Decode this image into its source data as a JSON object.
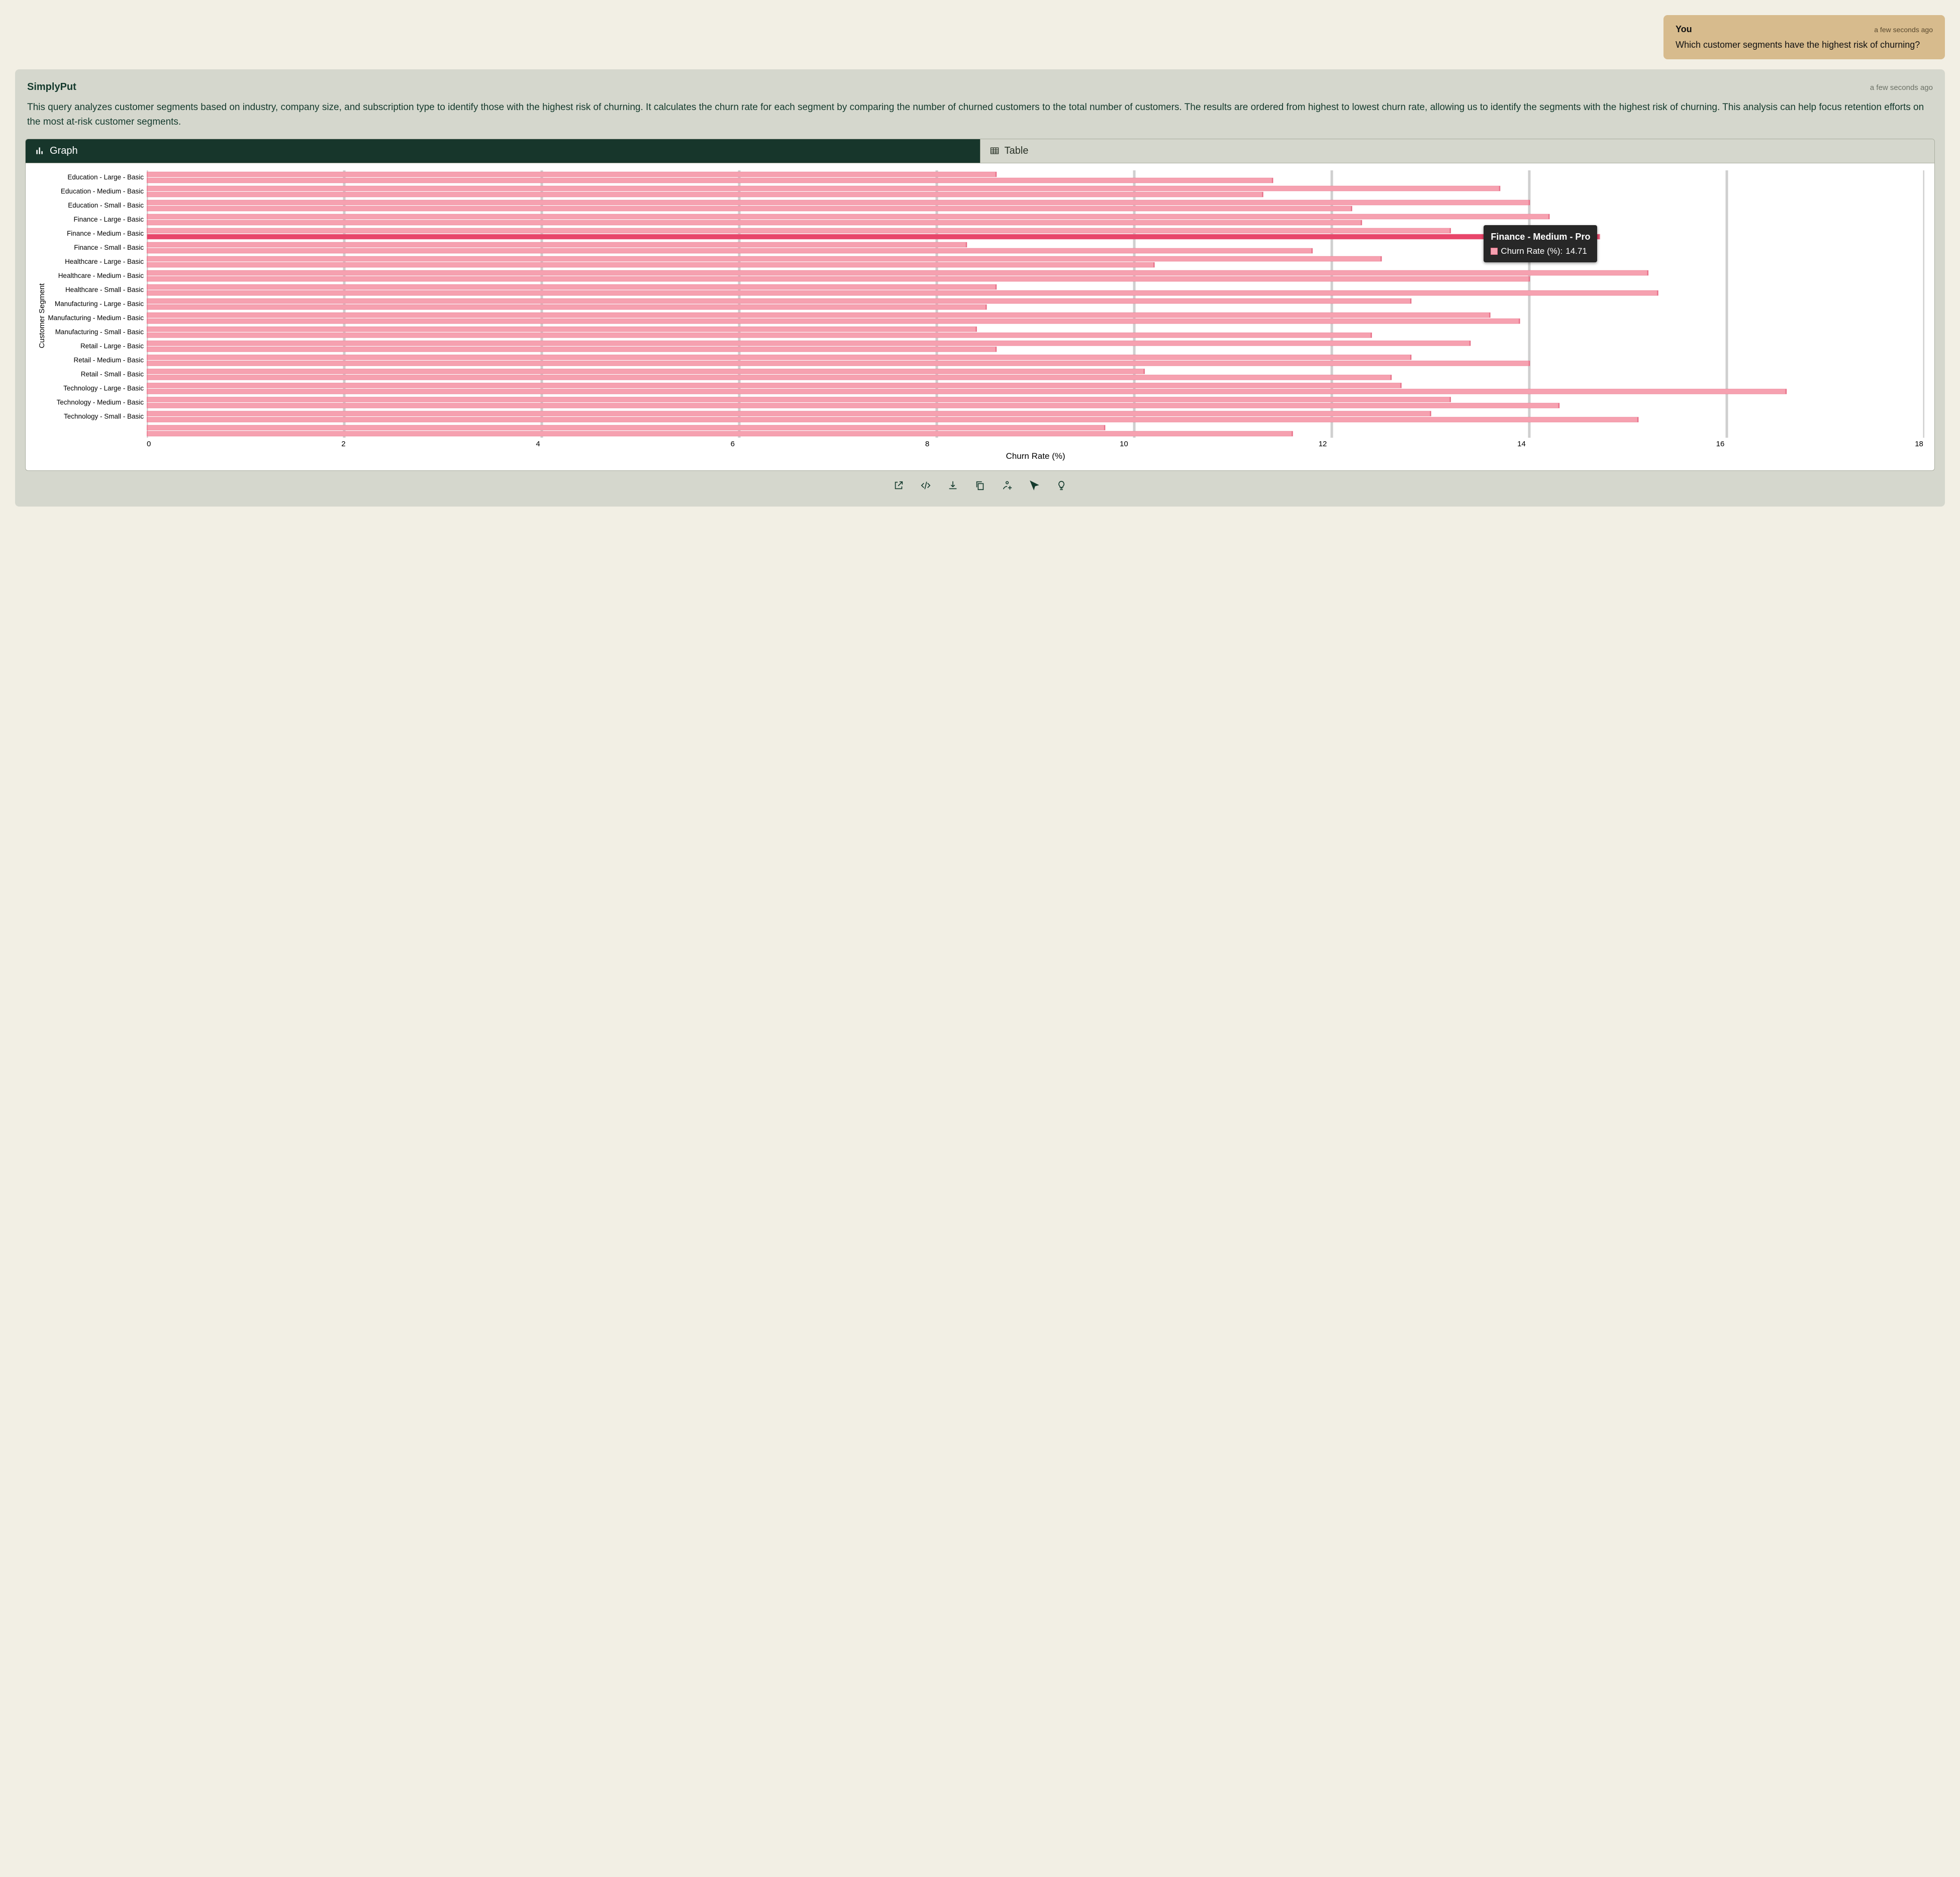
{
  "user_message": {
    "author": "You",
    "timestamp": "a few seconds ago",
    "text": "Which customer segments have the highest risk of churning?"
  },
  "assistant_message": {
    "author": "SimplyPut",
    "timestamp": "a few seconds ago",
    "text": "This query analyzes customer segments based on industry, company size, and subscription type to identify those with the highest risk of churning. It calculates the churn rate for each segment by comparing the number of churned customers to the total number of customers. The results are ordered from highest to lowest churn rate, allowing us to identify the segments with the highest risk of churning. This analysis can help focus retention efforts on the most at-risk customer segments."
  },
  "tabs": {
    "graph": "Graph",
    "table": "Table",
    "active": "graph"
  },
  "tooltip": {
    "title": "Finance - Medium - Pro",
    "metric_label": "Churn Rate (%):",
    "value": "14.71"
  },
  "toolbar_icons": [
    "open-external",
    "code",
    "download",
    "copy",
    "user-settings",
    "cursor",
    "idea"
  ],
  "chart_data": {
    "type": "bar",
    "orientation": "horizontal",
    "title": "",
    "xlabel": "Churn Rate (%)",
    "ylabel": "Customer Segment",
    "xlim": [
      0,
      18
    ],
    "xticks": [
      0,
      2,
      4,
      6,
      8,
      10,
      12,
      14,
      16,
      18
    ],
    "series_name": "Churn Rate (%)",
    "segments": [
      {
        "label": "Education - Large - Basic",
        "bars": [
          8.6,
          11.4
        ]
      },
      {
        "label": "Education - Medium - Basic",
        "bars": [
          13.7,
          11.3
        ]
      },
      {
        "label": "Education - Small - Basic",
        "bars": [
          14.0,
          12.2
        ]
      },
      {
        "label": "Finance - Large - Basic",
        "bars": [
          14.2,
          12.3
        ]
      },
      {
        "label": "Finance - Medium - Basic",
        "bars": [
          13.2,
          14.71
        ],
        "highlight_index": 1,
        "highlight_label": "Finance - Medium - Pro"
      },
      {
        "label": "Finance - Small - Basic",
        "bars": [
          8.3,
          11.8
        ]
      },
      {
        "label": "Healthcare - Large - Basic",
        "bars": [
          12.5,
          10.2
        ]
      },
      {
        "label": "Healthcare - Medium - Basic",
        "bars": [
          15.2,
          14.0
        ]
      },
      {
        "label": "Healthcare - Small - Basic",
        "bars": [
          8.6,
          15.3
        ]
      },
      {
        "label": "Manufacturing - Large - Basic",
        "bars": [
          12.8,
          8.5
        ]
      },
      {
        "label": "Manufacturing - Medium - Basic",
        "bars": [
          13.6,
          13.9
        ]
      },
      {
        "label": "Manufacturing - Small - Basic",
        "bars": [
          8.4,
          12.4
        ]
      },
      {
        "label": "Retail - Large - Basic",
        "bars": [
          13.4,
          8.6
        ]
      },
      {
        "label": "Retail - Medium - Basic",
        "bars": [
          12.8,
          14.0
        ]
      },
      {
        "label": "Retail - Small - Basic",
        "bars": [
          10.1,
          12.6
        ]
      },
      {
        "label": "Technology - Large - Basic",
        "bars": [
          12.7,
          16.6
        ]
      },
      {
        "label": "Technology - Medium - Basic",
        "bars": [
          13.2,
          14.3
        ]
      },
      {
        "label": "Technology - Small - Basic",
        "bars": [
          13.0,
          15.1
        ]
      },
      {
        "label": "",
        "bars": [
          9.7,
          11.6
        ]
      }
    ]
  }
}
